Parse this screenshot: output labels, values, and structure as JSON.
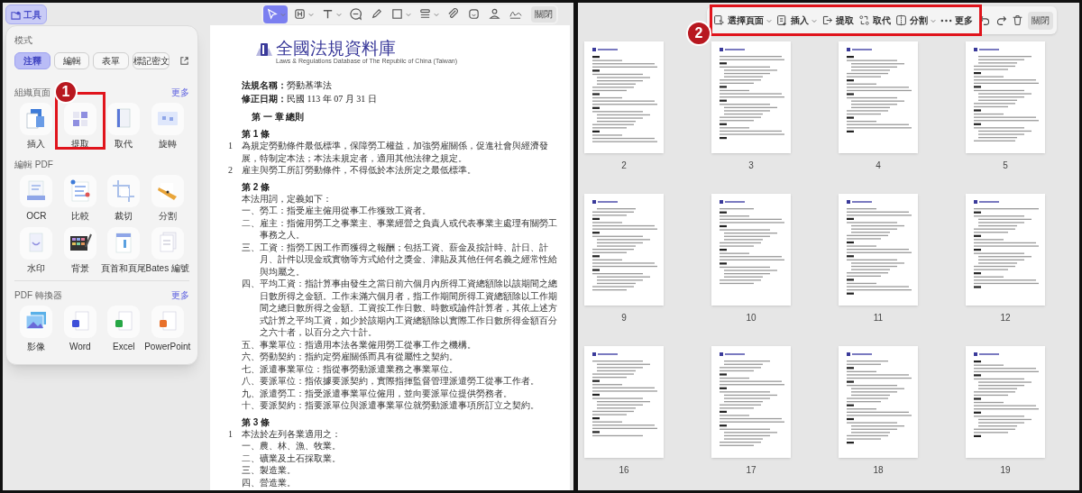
{
  "tools_button": {
    "label": "工具"
  },
  "tools_panel": {
    "mode": {
      "heading": "模式",
      "buttons": [
        {
          "label": "注釋",
          "selected": true
        },
        {
          "label": "編輯",
          "selected": false
        },
        {
          "label": "表單",
          "selected": false
        },
        {
          "label": "標記密文",
          "selected": false
        }
      ]
    },
    "sections": [
      {
        "heading": "組織頁面",
        "more": "更多",
        "items": [
          "插入",
          "提取",
          "取代",
          "旋轉"
        ]
      },
      {
        "heading": "編輯 PDF",
        "items": [
          "OCR",
          "比較",
          "裁切",
          "分割",
          "水印",
          "背景",
          "頁首和頁尾",
          "Bates 編號"
        ]
      },
      {
        "heading": "PDF 轉換器",
        "more": "更多",
        "items": [
          "影像",
          "Word",
          "Excel",
          "PowerPoint"
        ]
      }
    ]
  },
  "annotation_toolbar": {
    "tools": [
      {
        "selected": true,
        "dropdown": true
      },
      {
        "selected": false,
        "dropdown": true
      },
      {
        "selected": false,
        "dropdown": true
      },
      {
        "selected": false,
        "dropdown": false
      },
      {
        "selected": false,
        "dropdown": false
      },
      {
        "selected": false,
        "dropdown": true
      },
      {
        "selected": false,
        "dropdown": true
      },
      {
        "selected": false,
        "dropdown": false
      },
      {
        "selected": false,
        "dropdown": false
      },
      {
        "selected": false,
        "dropdown": false
      },
      {
        "selected": false,
        "dropdown": false
      }
    ],
    "close": "關閉"
  },
  "document": {
    "logo_title": "全國法規資料庫",
    "logo_subtitle": "Laws & Regulations Database of The Republic of China (Taiwan)",
    "meta": [
      {
        "label": "法規名稱：",
        "value": "勞動基準法"
      },
      {
        "label": "修正日期：",
        "value": "民國 113 年 07 月 31 日"
      }
    ],
    "chapter": "第 一 章 總則",
    "blocks": [
      {
        "kind": "heading",
        "text": "第 1 條"
      },
      {
        "kind": "paragraph",
        "number": "1",
        "text": "為規定勞動條件最低標準，保障勞工權益，加強勞雇關係，促進社會與經濟發展，特制定本法；本法未規定者，適用其他法律之規定。"
      },
      {
        "kind": "paragraph",
        "number": "2",
        "text": "雇主與勞工所訂勞動條件，不得低於本法所定之最低標準。"
      },
      {
        "kind": "heading",
        "text": "第 2 條"
      },
      {
        "kind": "paragraph",
        "text": "本法用詞，定義如下："
      },
      {
        "kind": "item",
        "text": "一、勞工：指受雇主僱用從事工作獲致工資者。"
      },
      {
        "kind": "item",
        "text": "二、雇主：指僱用勞工之事業主、事業經營之負責人或代表事業主處理有關勞工事務之人。"
      },
      {
        "kind": "item",
        "text": "三、工資：指勞工因工作而獲得之報酬；包括工資、薪金及按計時、計日、計月、計件以現金或實物等方式給付之獎金、津貼及其他任何名義之經常性給與均屬之。"
      },
      {
        "kind": "item",
        "text": "四、平均工資：指計算事由發生之當日前六個月內所得工資總額除以該期間之總日數所得之金額。工作未滿六個月者，指工作期間所得工資總額除以工作期間之總日數所得之金額。工資按工作日數、時數或論件計算者，其依上述方式計算之平均工資，如少於該期內工資總額除以實際工作日數所得金額百分之六十者，以百分之六十計。"
      },
      {
        "kind": "item",
        "text": "五、事業單位：指適用本法各業僱用勞工從事工作之機構。"
      },
      {
        "kind": "item",
        "text": "六、勞動契約：指約定勞雇關係而具有從屬性之契約。"
      },
      {
        "kind": "item",
        "text": "七、派遣事業單位：指從事勞動派遣業務之事業單位。"
      },
      {
        "kind": "item",
        "text": "八、要派單位：指依據要派契約，實際指揮監督管理派遣勞工從事工作者。"
      },
      {
        "kind": "item",
        "text": "九、派遣勞工：指受派遣事業單位僱用，並向要派單位提供勞務者。"
      },
      {
        "kind": "item",
        "text": "十、要派契約：指要派單位與派遣事業單位就勞動派遣事項所訂立之契約。"
      },
      {
        "kind": "heading",
        "text": "第 3 條"
      },
      {
        "kind": "paragraph",
        "number": "1",
        "text": "本法於左列各業適用之："
      },
      {
        "kind": "item",
        "text": "一、農、林、漁、牧業。"
      },
      {
        "kind": "item",
        "text": "二、礦業及土石採取業。"
      },
      {
        "kind": "item",
        "text": "三、製造業。"
      },
      {
        "kind": "item",
        "text": "四、營造業。"
      }
    ]
  },
  "page_toolbar": {
    "items": [
      {
        "label": "選擇頁面",
        "dropdown": true
      },
      {
        "label": "插入",
        "dropdown": true
      },
      {
        "label": "提取",
        "dropdown": false
      },
      {
        "label": "取代",
        "dropdown": false
      },
      {
        "label": "分割",
        "dropdown": true
      },
      {
        "label": "更多",
        "dropdown": false
      }
    ],
    "close": "關閉"
  },
  "pages": [
    "2",
    "3",
    "4",
    "5",
    "9",
    "10",
    "11",
    "12",
    "16",
    "17",
    "18",
    "19"
  ],
  "callouts": [
    {
      "label": "1"
    },
    {
      "label": "2"
    }
  ]
}
